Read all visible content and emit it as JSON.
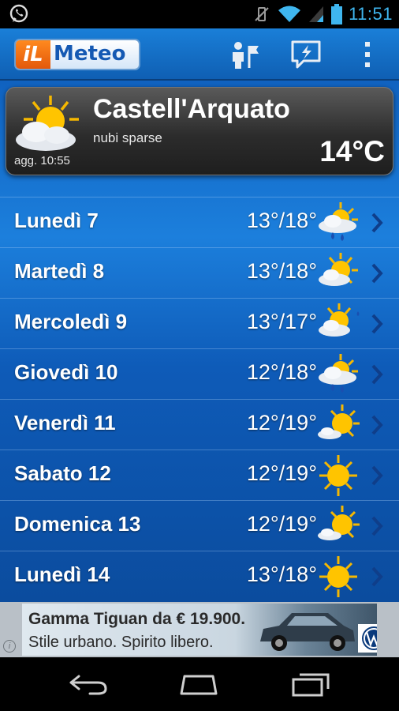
{
  "status_bar": {
    "time": "11:51",
    "icons": [
      "whatsapp-icon",
      "vibrate-off-icon",
      "wifi-icon",
      "signal-icon",
      "battery-icon"
    ]
  },
  "app_bar": {
    "logo_prefix": "iL",
    "logo_word": "Meteo",
    "actions": [
      "places-icon",
      "alerts-icon",
      "overflow-menu-icon"
    ]
  },
  "current": {
    "city": "Castell'Arquato",
    "condition": "nubi sparse",
    "updated": "agg. 10:55",
    "temperature": "14°C",
    "icon": "sun-behind-clouds-icon"
  },
  "forecast": [
    {
      "day": "Lunedì 7",
      "temp": "13°/18°",
      "icon": "rain-sun-cloud-icon"
    },
    {
      "day": "Martedì 8",
      "temp": "13°/18°",
      "icon": "sun-cloud-icon"
    },
    {
      "day": "Mercoledì 9",
      "temp": "13°/17°",
      "icon": "sun-cloud-drizzle-icon"
    },
    {
      "day": "Giovedì 10",
      "temp": "12°/18°",
      "icon": "rain-sun-cloud-icon"
    },
    {
      "day": "Venerdì 11",
      "temp": "12°/19°",
      "icon": "sun-small-cloud-icon"
    },
    {
      "day": "Sabato 12",
      "temp": "12°/19°",
      "icon": "sun-icon"
    },
    {
      "day": "Domenica 13",
      "temp": "12°/19°",
      "icon": "sun-small-cloud-icon"
    },
    {
      "day": "Lunedì 14",
      "temp": "13°/18°",
      "icon": "sun-icon"
    }
  ],
  "ad": {
    "line1": "Gamma Tiguan da € 19.900.",
    "line2": "Stile urbano. Spirito libero.",
    "info_glyph": "i"
  },
  "nav_bar": [
    "back-icon",
    "home-icon",
    "recent-apps-icon"
  ]
}
